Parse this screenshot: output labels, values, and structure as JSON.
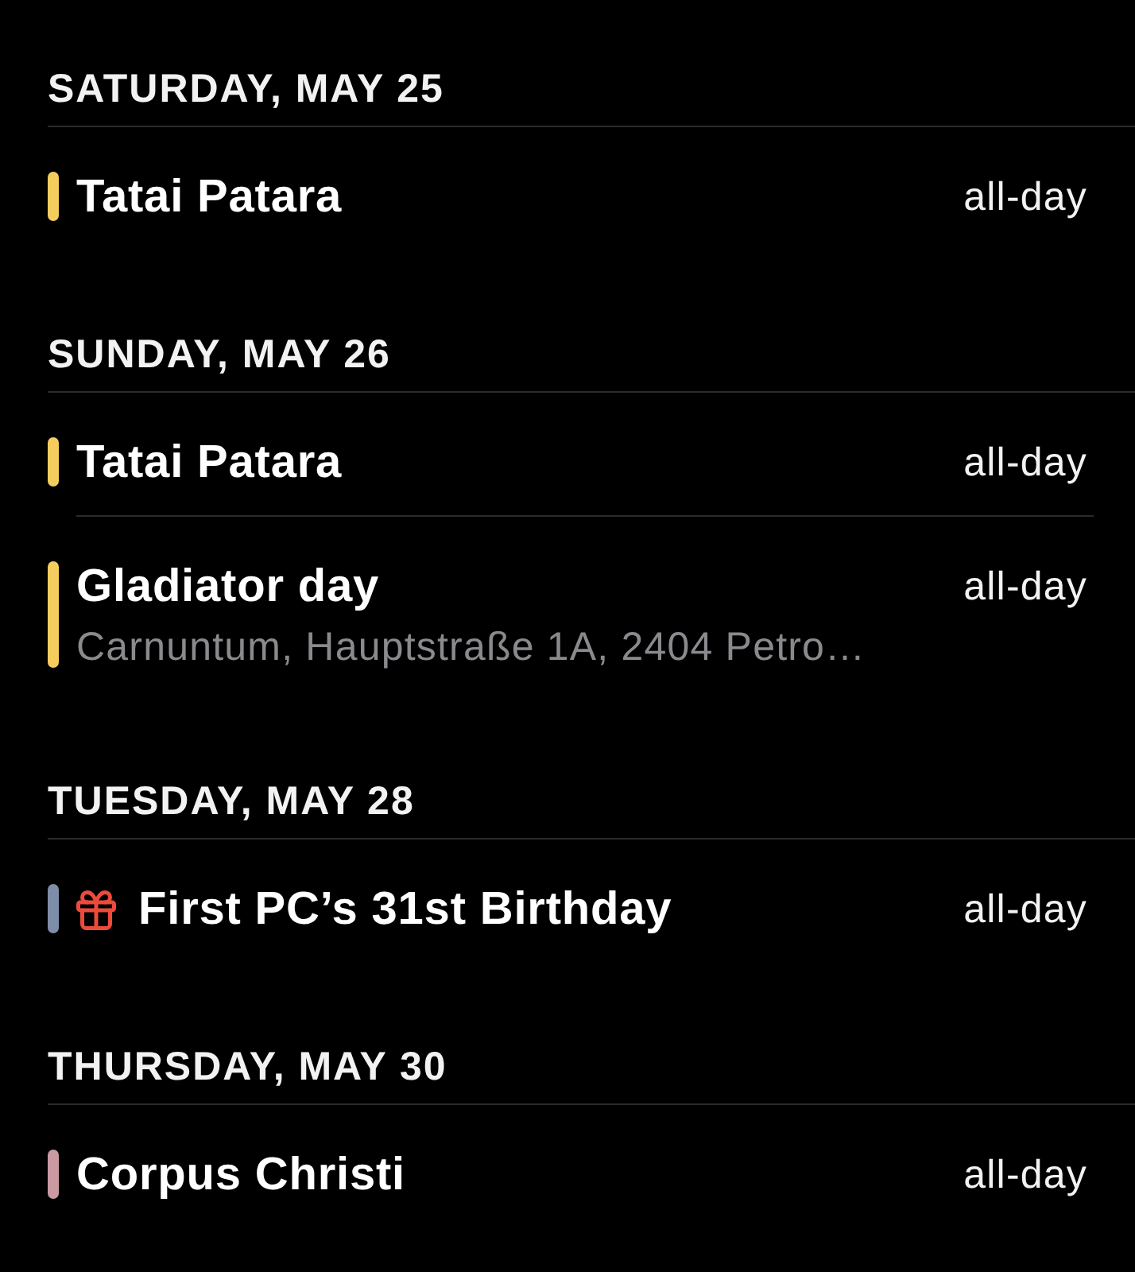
{
  "sections": [
    {
      "heading": "SATURDAY, MAY 25",
      "events": [
        {
          "kind": "event",
          "title": "Tatai Patara",
          "time": "all-day",
          "color": "#f5cd5f"
        }
      ]
    },
    {
      "heading": "SUNDAY, MAY 26",
      "events": [
        {
          "kind": "event",
          "title": "Tatai Patara",
          "time": "all-day",
          "color": "#f5cd5f"
        },
        {
          "kind": "event",
          "title": "Gladiator day",
          "time": "all-day",
          "location": "Carnuntum, Hauptstraße 1A, 2404 Petro…",
          "color": "#f5cd5f"
        }
      ]
    },
    {
      "heading": "TUESDAY, MAY 28",
      "events": [
        {
          "kind": "birthday",
          "title": "First PC’s 31st Birthday",
          "time": "all-day",
          "color": "#7e8ea8"
        }
      ]
    },
    {
      "heading": "THURSDAY, MAY 30",
      "events": [
        {
          "kind": "event",
          "title": "Corpus Christi",
          "time": "all-day",
          "color": "#c99aa2"
        }
      ]
    }
  ]
}
